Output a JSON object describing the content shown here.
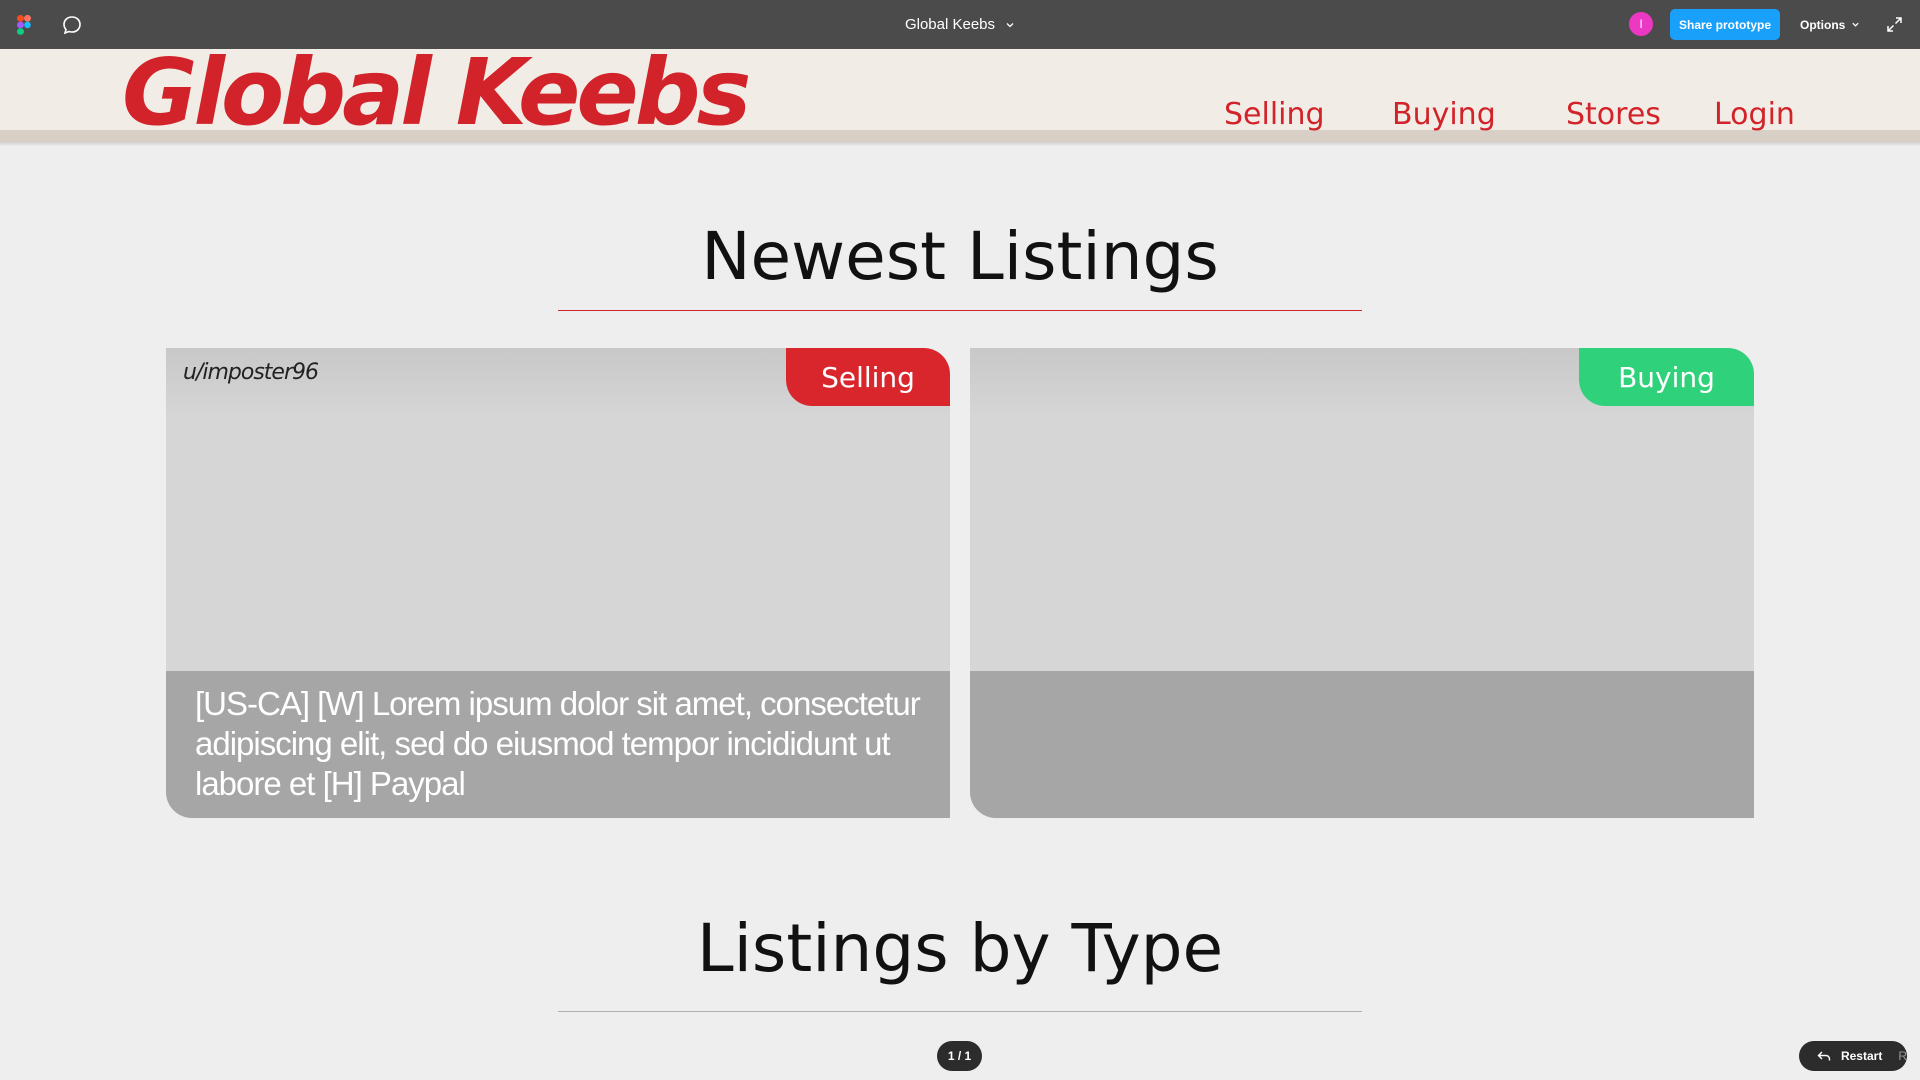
{
  "toolbar": {
    "file_title": "Global Keebs",
    "avatar_initial": "I",
    "avatar_color": "#ec38c2",
    "share_label": "Share prototype",
    "share_color": "#18a0fb",
    "options_label": "Options",
    "icons": [
      "figma-logo-icon",
      "comment-icon",
      "chevron-down-icon",
      "expand-icon"
    ]
  },
  "site": {
    "logo": "Global Keebs",
    "brand_color": "#d3232a",
    "nav": [
      {
        "label": "Selling"
      },
      {
        "label": "Buying"
      },
      {
        "label": "Stores"
      },
      {
        "label": "Login"
      }
    ]
  },
  "newest": {
    "title": "Newest Listings",
    "listings": [
      {
        "user": "u/imposter96",
        "badge": "Selling",
        "badge_color": "#d9262c",
        "description": "[US-CA] [W] Lorem ipsum dolor sit amet, consectetur adipiscing elit, sed do eiusmod tempor incididunt ut labore et [H] Paypal"
      },
      {
        "user": "",
        "badge": "Buying",
        "badge_color": "#2fd27a",
        "description": ""
      }
    ]
  },
  "by_type": {
    "title": "Listings by Type"
  },
  "prototype": {
    "page_counter": "1 / 1",
    "restart_label": "Restart",
    "restart_shortcut": "R"
  }
}
